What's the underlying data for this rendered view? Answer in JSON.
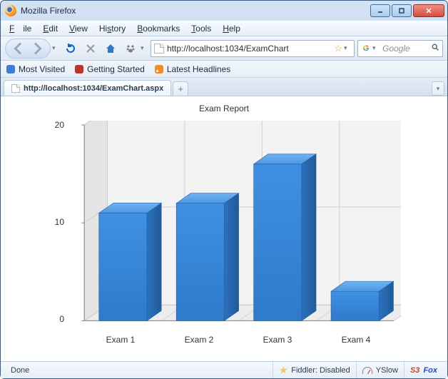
{
  "window": {
    "title": "Mozilla Firefox"
  },
  "menubar": {
    "file": "File",
    "edit": "Edit",
    "view": "View",
    "history": "History",
    "bookmarks": "Bookmarks",
    "tools": "Tools",
    "help": "Help"
  },
  "toolbar": {
    "url": "http://localhost:1034/ExamChart",
    "search_placeholder": "Google"
  },
  "bookmarks_bar": {
    "most_visited": "Most Visited",
    "getting_started": "Getting Started",
    "latest_headlines": "Latest Headlines"
  },
  "tabs": {
    "active_label": "http://localhost:1034/ExamChart.aspx"
  },
  "statusbar": {
    "status": "Done",
    "fiddler": "Fiddler: Disabled",
    "yslow": "YSlow",
    "s3fox_s3": "S3",
    "s3fox_fox": "Fox"
  },
  "chart_data": {
    "type": "bar",
    "title": "Exam Report",
    "categories": [
      "Exam 1",
      "Exam 2",
      "Exam 3",
      "Exam 4"
    ],
    "values": [
      11,
      12,
      16,
      3
    ],
    "xlabel": "",
    "ylabel": "",
    "ylim": [
      0,
      20
    ],
    "yticks": [
      0,
      10,
      20
    ]
  }
}
